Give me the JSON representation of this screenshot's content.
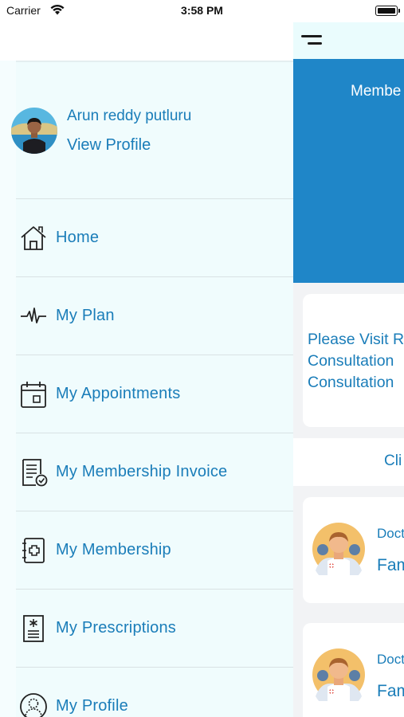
{
  "status_bar": {
    "carrier": "Carrier",
    "time": "3:58 PM"
  },
  "main": {
    "banner_title": "Membe",
    "notice_lines": "Please Visit R\nConsultation \nConsultation",
    "tab_label": "Cli",
    "doctor_cards": [
      {
        "label": "Doct",
        "name": "Fam"
      },
      {
        "label": "Doct",
        "name": "Fam"
      }
    ],
    "colors": {
      "banner": "#1f86c8",
      "accent": "#1a7db9"
    }
  },
  "drawer": {
    "user_name": "Arun reddy putluru",
    "view_profile": "View Profile",
    "items": [
      {
        "label": "Home",
        "icon": "home-icon"
      },
      {
        "label": "My Plan",
        "icon": "heartbeat-icon"
      },
      {
        "label": "My Appointments",
        "icon": "calendar-icon"
      },
      {
        "label": "My Membership Invoice",
        "icon": "invoice-icon"
      },
      {
        "label": "My Membership",
        "icon": "medical-book-icon"
      },
      {
        "label": "My Prescriptions",
        "icon": "prescription-icon"
      },
      {
        "label": "My Profile",
        "icon": "user-profile-icon"
      }
    ],
    "colors": {
      "background": "#f0fcfd",
      "text": "#1a7db9"
    }
  }
}
